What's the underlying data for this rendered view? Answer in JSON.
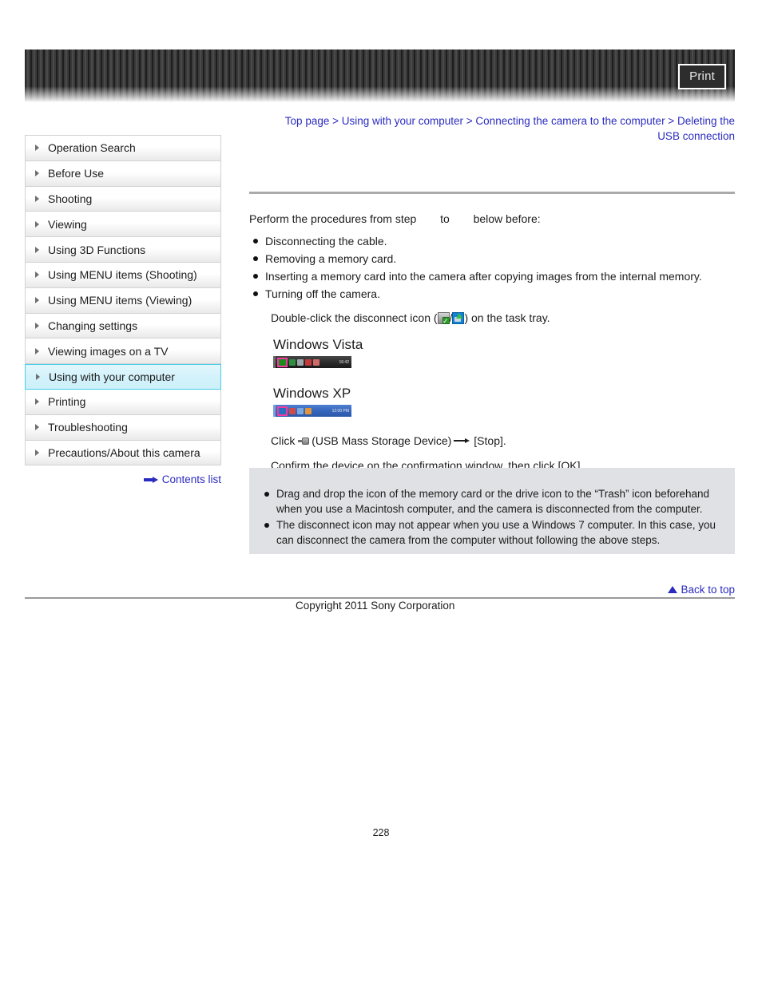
{
  "header": {
    "print_label": "Print"
  },
  "breadcrumb": {
    "items": [
      "Top page",
      "Using with your computer",
      "Connecting the camera to the computer",
      "Deleting the USB connection"
    ],
    "separator": ">",
    "line1": "Top page > Using with your computer > Connecting the camera to the computer > Deleting the",
    "line2": "USB connection"
  },
  "sidebar": {
    "items": [
      {
        "label": "Operation Search",
        "active": false
      },
      {
        "label": "Before Use",
        "active": false
      },
      {
        "label": "Shooting",
        "active": false
      },
      {
        "label": "Viewing",
        "active": false
      },
      {
        "label": "Using 3D Functions",
        "active": false
      },
      {
        "label": "Using MENU items (Shooting)",
        "active": false
      },
      {
        "label": "Using MENU items (Viewing)",
        "active": false
      },
      {
        "label": "Changing settings",
        "active": false
      },
      {
        "label": "Viewing images on a TV",
        "active": false
      },
      {
        "label": "Using with your computer",
        "active": true
      },
      {
        "label": "Printing",
        "active": false
      },
      {
        "label": "Troubleshooting",
        "active": false
      },
      {
        "label": "Precautions/About this camera",
        "active": false
      }
    ],
    "contents_link": "Contents list"
  },
  "main": {
    "intro_before": "Perform the procedures from step",
    "intro_mid": "to",
    "intro_after": "below before:",
    "bullets": [
      "Disconnecting the cable.",
      "Removing a memory card.",
      "Inserting a memory card into the camera after copying images from the internal memory.",
      "Turning off the camera."
    ],
    "step_double_click_before": "Double-click the disconnect icon (",
    "step_double_click_sep": "/",
    "step_double_click_after": ") on the task tray.",
    "figures": [
      {
        "title": "Windows Vista",
        "clock": "16:42"
      },
      {
        "title": "Windows XP",
        "clock": "12:00 PM"
      }
    ],
    "step_click_before": "Click",
    "step_click_mid": "(USB Mass Storage Device)",
    "step_click_after": "[Stop].",
    "step_confirm": "Confirm the device on the confirmation window, then click [OK]."
  },
  "note_box": {
    "notes": [
      "Drag and drop the icon of the memory card or the drive icon to the “Trash” icon beforehand when you use a Macintosh computer, and the camera is disconnected from the computer.",
      "The disconnect icon may not appear when you use a Windows 7 computer. In this case, you can disconnect the camera from the computer without following the above steps."
    ]
  },
  "footer": {
    "back_to_top": "Back to top",
    "copyright": "Copyright 2011 Sony Corporation",
    "page_number": "228"
  },
  "colors": {
    "link": "#2b2bc0",
    "active_border": "#49cbe8",
    "note_bg": "#dfe1e4",
    "highlight_pink": "#f23ba0"
  }
}
